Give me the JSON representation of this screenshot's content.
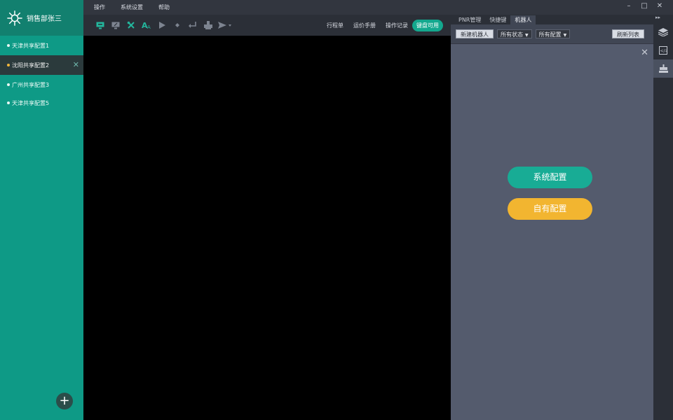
{
  "sidebar": {
    "user_name": "销售部张三",
    "sessions": [
      {
        "label": "天津共享配置1",
        "active": false,
        "dot": "#e8f8f4"
      },
      {
        "label": "沈阳共享配置2",
        "active": true,
        "dot": "#f3b63a"
      },
      {
        "label": "广州共享配置3",
        "active": false,
        "dot": "#e8f8f4"
      },
      {
        "label": "天津共享配置5",
        "active": false,
        "dot": "#e8f8f4"
      }
    ],
    "add_label": "+"
  },
  "menu": {
    "items": [
      "操作",
      "系统设置",
      "帮助"
    ]
  },
  "window_controls": {
    "minimize": "–",
    "maximize": "□",
    "close": "✕"
  },
  "toolbar": {
    "links": [
      "行程单",
      "运价手册",
      "操作记录"
    ],
    "keyboard_status": "键盘可用",
    "icons": [
      "monitor-icon",
      "screen-edit-icon",
      "tools-icon",
      "font-size-icon",
      "play-icon",
      "dot-icon",
      "enter-icon",
      "print-icon",
      "send-icon"
    ]
  },
  "panel": {
    "tabs": [
      "PNR管理",
      "快捷键",
      "机器人"
    ],
    "active_tab": 2,
    "new_robot": "新建机器人",
    "status_filter": "所有状态",
    "config_filter": "所有配置",
    "refresh": "刷新列表",
    "system_config": "系统配置",
    "own_config": "自有配置"
  },
  "colors": {
    "sidebar": "#0e9a86",
    "accent_teal": "#18ac95",
    "accent_yellow": "#f2b530",
    "panel_bg": "#545b6d"
  }
}
